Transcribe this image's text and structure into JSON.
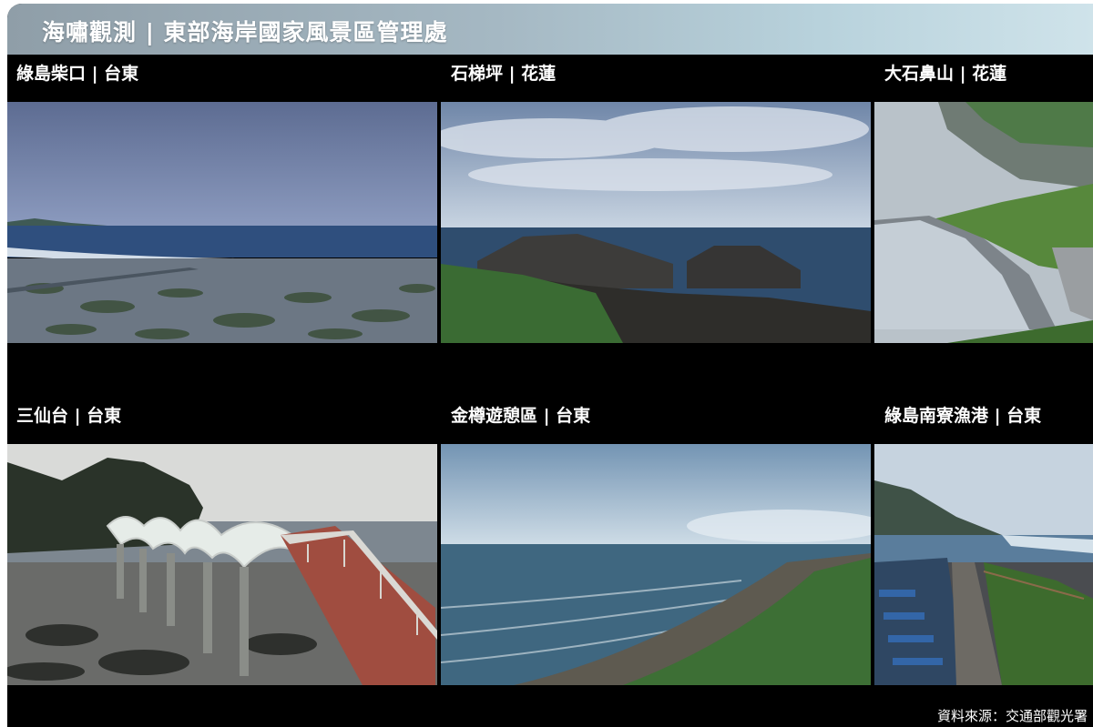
{
  "title": "海嘯觀測 | 東部海岸國家風景區管理處",
  "cameras": [
    {
      "label": "綠島柴口 | 台東"
    },
    {
      "label": "石梯坪 | 花蓮"
    },
    {
      "label": "大石鼻山 | 花蓮"
    },
    {
      "label": "三仙台 | 台東"
    },
    {
      "label": "金樽遊憩區 | 台東"
    },
    {
      "label": "綠島南寮漁港 | 台東"
    }
  ],
  "source": "資料來源：交通部觀光署",
  "colors": {
    "title_bar": "#a5b8c3",
    "background": "#000000",
    "text": "#ffffff"
  }
}
